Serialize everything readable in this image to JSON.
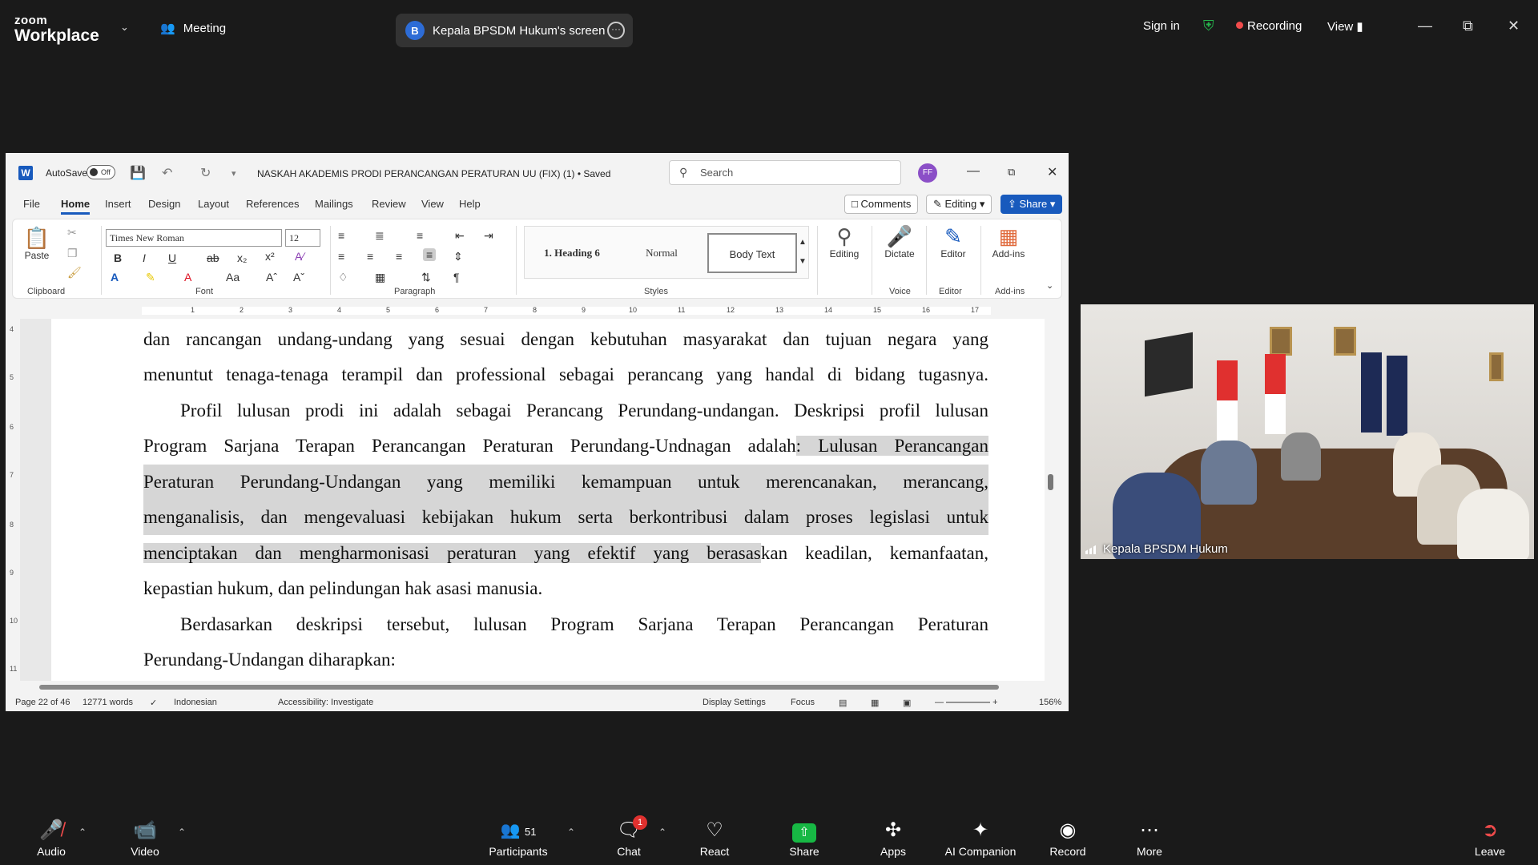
{
  "zoom": {
    "logo_line1": "zoom",
    "logo_line2": "Workplace",
    "meeting_label": "Meeting",
    "screen_share_badge": "B",
    "screen_share_label": "Kepala BPSDM Hukum's screen",
    "sign_in": "Sign in",
    "recording": "Recording",
    "view": "View",
    "colors": {
      "bg": "#1a1a1a",
      "recording": "#f04b4b",
      "share": "#17b844",
      "shield": "#25b34b"
    }
  },
  "word": {
    "autosave_label": "AutoSave",
    "autosave_state": "Off",
    "doc_title": "NASKAH AKADEMIS PRODI PERANCANGAN PERATURAN UU (FIX) (1) • Saved",
    "search_placeholder": "Search",
    "avatar_initials": "FF",
    "tabs": [
      "File",
      "Home",
      "Insert",
      "Design",
      "Layout",
      "References",
      "Mailings",
      "Review",
      "View",
      "Help"
    ],
    "active_tab": "Home",
    "comments_label": "Comments",
    "editing_label": "Editing",
    "share_label": "Share",
    "ribbon": {
      "paste_label": "Paste",
      "font_name": "Times New Roman",
      "font_size": "12",
      "styles": [
        "1.  Heading 6",
        "Normal",
        "Body Text"
      ],
      "editing_label": "Editing",
      "dictate_label": "Dictate",
      "editor_label": "Editor",
      "addins_label": "Add-ins",
      "groups": [
        "Clipboard",
        "Font",
        "Paragraph",
        "Styles",
        "Voice",
        "Editor",
        "Add-ins"
      ]
    },
    "ruler_numbers": [
      "1",
      "2",
      "3",
      "4",
      "5",
      "6",
      "7",
      "8",
      "9",
      "10",
      "11",
      "12",
      "13",
      "14",
      "15",
      "16",
      "17"
    ],
    "vruler_numbers": [
      "4",
      "5",
      "6",
      "7",
      "8",
      "9",
      "10",
      "11"
    ],
    "document": {
      "p1_l1": "dan rancangan undang-undang yang sesuai dengan kebutuhan masyarakat dan tujuan negara yang",
      "p1_l2": "menuntut tenaga-tenaga terampil  dan professional sebagai perancang  yang handal di bidang tugasnya.",
      "p2_l1": "Profil lulusan prodi ini adalah sebagai Perancang Perundang-undangan. Deskripsi profil lulusan",
      "p2_l2a": "Program Sarjana Terapan Perancangan Peraturan Perundang-Undnagan adalah",
      "p2_l2b": ": Lulusan Perancangan",
      "p2_l3": "Peraturan Perundang-Undangan yang memiliki kemampuan untuk merencanakan, merancang,",
      "p2_l4": "menganalisis, dan mengevaluasi kebijakan hukum serta berkontribusi dalam proses legislasi untuk",
      "p2_l5a": "menciptakan dan mengharmonisasi peraturan yang efektif yang berasas",
      "p2_l5b": "kan  keadilan,  kemanfaatan,",
      "p2_l6": "kepastian hukum, dan pelindungan hak asasi manusia.",
      "p3_l1": "Berdasarkan deskripsi tersebut, lulusan Program Sarjana Terapan Perancangan Peraturan",
      "p3_l2": "Perundang-Undangan diharapkan:"
    },
    "status": {
      "page": "Page 22 of 46",
      "words": "12771 words",
      "language": "Indonesian",
      "accessibility": "Accessibility: Investigate",
      "display_settings": "Display Settings",
      "focus": "Focus",
      "zoom": "156%"
    },
    "colors": {
      "accent": "#185abd",
      "highlight": "#d6d6d6"
    }
  },
  "video": {
    "participant_name": "Kepala BPSDM Hukum"
  },
  "toolbar": {
    "audio": "Audio",
    "video": "Video",
    "participants": "Participants",
    "participant_count": "51",
    "chat": "Chat",
    "chat_badge": "1",
    "react": "React",
    "share": "Share",
    "apps": "Apps",
    "ai_companion": "AI Companion",
    "record": "Record",
    "more": "More",
    "leave": "Leave"
  }
}
